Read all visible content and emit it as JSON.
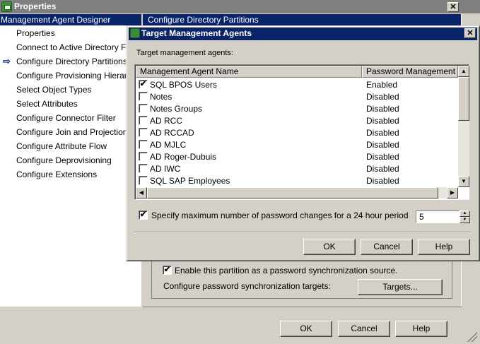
{
  "window": {
    "title": "Properties",
    "close_glyph": "✕"
  },
  "header": {
    "left": "Management Agent Designer",
    "right": "Configure Directory Partitions"
  },
  "nav": {
    "items": [
      {
        "label": "Properties"
      },
      {
        "label": "Connect to Active Directory Forest"
      },
      {
        "label": "Configure Directory Partitions",
        "selected": true
      },
      {
        "label": "Configure Provisioning Hierarchy"
      },
      {
        "label": "Select Object Types"
      },
      {
        "label": "Select Attributes"
      },
      {
        "label": "Configure Connector Filter"
      },
      {
        "label": "Configure Join and Projection Rules"
      },
      {
        "label": "Configure Attribute Flow"
      },
      {
        "label": "Configure Deprovisioning"
      },
      {
        "label": "Configure Extensions"
      }
    ]
  },
  "partition": {
    "enable_label": "Enable this partition as a password synchronization source.",
    "enable_checked": true,
    "configure_label": "Configure password synchronization targets:",
    "targets_button": "Targets..."
  },
  "footer": {
    "ok": "OK",
    "cancel": "Cancel",
    "help": "Help"
  },
  "dialog": {
    "title": "Target Management Agents",
    "close_glyph": "✕",
    "list_label": "Target management agents:",
    "columns": [
      "Management Agent Name",
      "Password Management"
    ],
    "rows": [
      {
        "name": "SQL BPOS Users",
        "password": "Enabled",
        "checked": true
      },
      {
        "name": "Notes",
        "password": "Disabled",
        "checked": false
      },
      {
        "name": "Notes Groups",
        "password": "Disabled",
        "checked": false
      },
      {
        "name": "AD RCC",
        "password": "Disabled",
        "checked": false
      },
      {
        "name": "AD RCCAD",
        "password": "Disabled",
        "checked": false
      },
      {
        "name": "AD MJLC",
        "password": "Disabled",
        "checked": false
      },
      {
        "name": "AD Roger-Dubuis",
        "password": "Disabled",
        "checked": false
      },
      {
        "name": "AD IWC",
        "password": "Disabled",
        "checked": false
      },
      {
        "name": "SQL SAP Employees",
        "password": "Disabled",
        "checked": false
      }
    ],
    "max_changes_label": "Specify maximum number of password changes for a 24 hour period",
    "max_changes_checked": true,
    "max_changes_value": "5",
    "ok": "OK",
    "cancel": "Cancel",
    "help": "Help"
  },
  "icons": {
    "check": "✔",
    "nav_arrow": "⇨",
    "up": "▲",
    "down": "▼",
    "left": "◀",
    "right": "▶"
  }
}
